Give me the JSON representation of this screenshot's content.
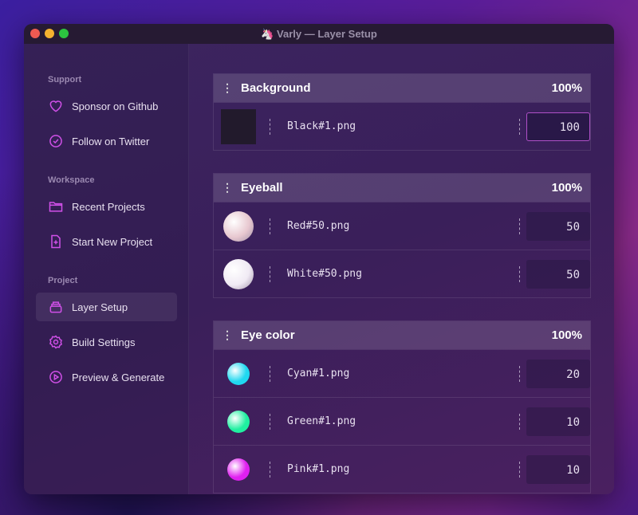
{
  "window": {
    "title": "🦄 Varly — Layer Setup"
  },
  "sidebar": {
    "sections": [
      {
        "label": "Support",
        "items": [
          {
            "label": "Sponsor on Github",
            "icon": "heart-icon"
          },
          {
            "label": "Follow on Twitter",
            "icon": "badge-check-icon"
          }
        ]
      },
      {
        "label": "Workspace",
        "items": [
          {
            "label": "Recent Projects",
            "icon": "folder-icon"
          },
          {
            "label": "Start New Project",
            "icon": "file-plus-icon"
          }
        ]
      },
      {
        "label": "Project",
        "items": [
          {
            "label": "Layer Setup",
            "icon": "layers-icon",
            "active": true
          },
          {
            "label": "Build Settings",
            "icon": "gear-icon"
          },
          {
            "label": "Preview & Generate",
            "icon": "play-circle-icon"
          }
        ]
      }
    ]
  },
  "layers": [
    {
      "name": "Background",
      "percent": "100%",
      "items": [
        {
          "file": "Black#1.png",
          "value": "100",
          "color": "#221a2c"
        }
      ]
    },
    {
      "name": "Eyeball",
      "percent": "100%",
      "items": [
        {
          "file": "Red#50.png",
          "value": "50",
          "color": "#e8c8d0"
        },
        {
          "file": "White#50.png",
          "value": "50",
          "color": "#f0eaf4"
        }
      ]
    },
    {
      "name": "Eye color",
      "percent": "100%",
      "items": [
        {
          "file": "Cyan#1.png",
          "value": "20",
          "color": "#20d8f0"
        },
        {
          "file": "Green#1.png",
          "value": "10",
          "color": "#20f0a0"
        },
        {
          "file": "Pink#1.png",
          "value": "10",
          "color": "#e020f0"
        }
      ]
    }
  ]
}
